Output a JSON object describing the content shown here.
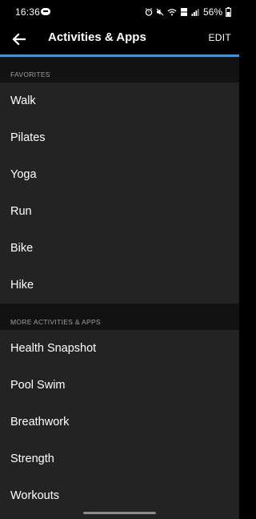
{
  "status_bar": {
    "time": "16:36",
    "battery_text": "56%",
    "icons": [
      "message-icon",
      "alarm-icon",
      "mute-icon",
      "wifi-icon",
      "volte-icon",
      "signal-icon",
      "battery-icon"
    ]
  },
  "header": {
    "title": "Activities & Apps",
    "edit_label": "EDIT",
    "back_icon": "arrow-left-icon",
    "accent_color": "#4a8fd0"
  },
  "favorites": {
    "heading": "FAVORITES",
    "items": [
      "Walk",
      "Pilates",
      "Yoga",
      "Run",
      "Bike",
      "Hike"
    ]
  },
  "more": {
    "heading": "MORE ACTIVITIES & APPS",
    "items": [
      "Health Snapshot",
      "Pool Swim",
      "Breathwork",
      "Strength",
      "Workouts"
    ]
  }
}
